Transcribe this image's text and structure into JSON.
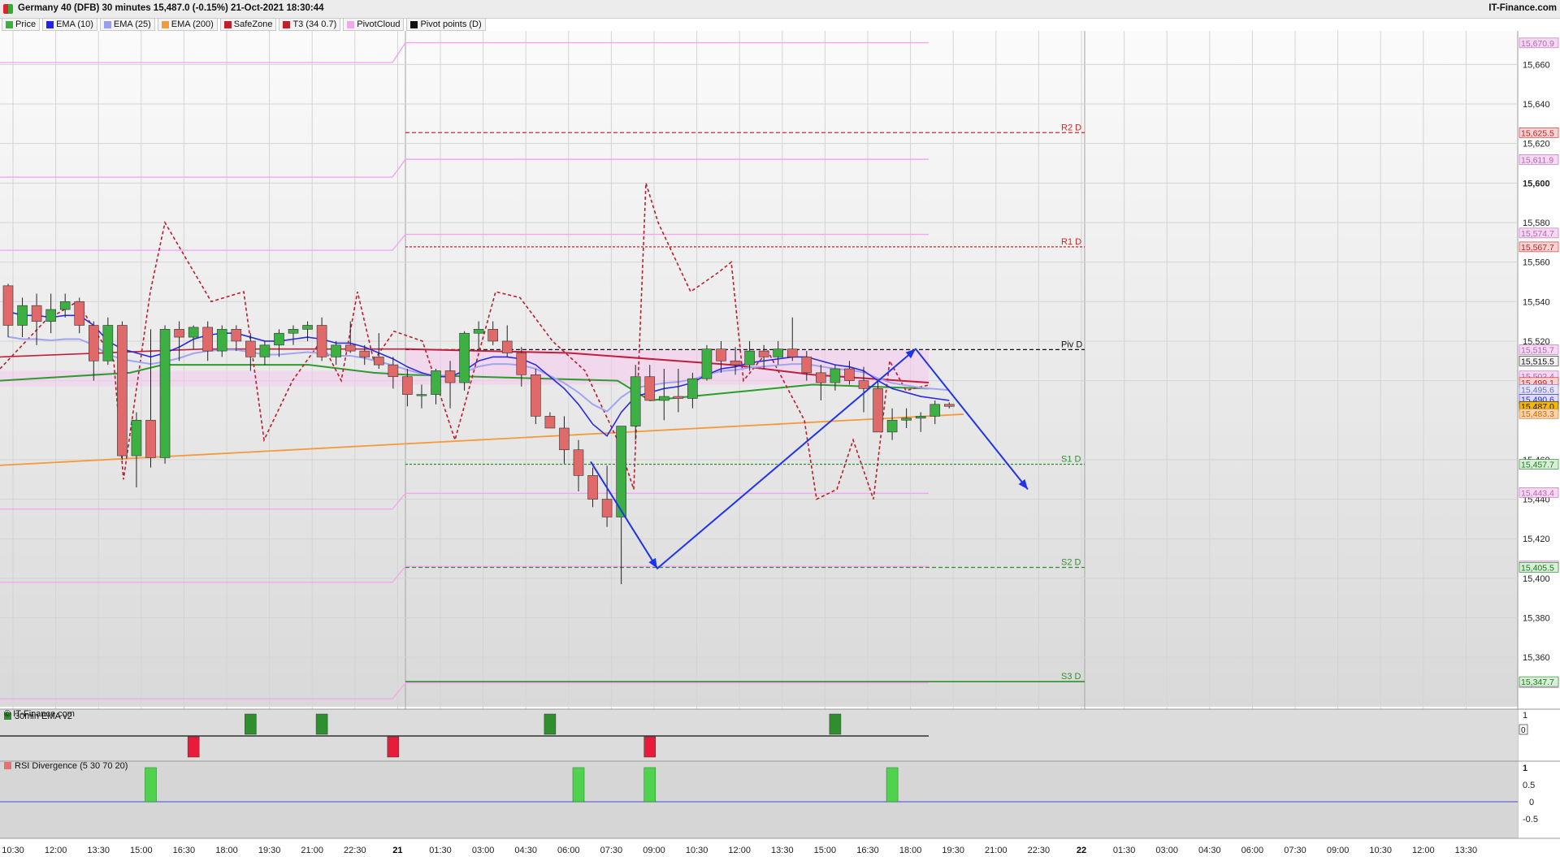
{
  "header": {
    "title": "Germany 40 (DFB) 30 minutes 15,487.0 (-0.15%) 21-Oct-2021 18:30:44",
    "brand": "IT-Finance.com"
  },
  "legend": [
    {
      "label": "Price",
      "color": "#3cb043"
    },
    {
      "label": "EMA (10)",
      "color": "#2222ee"
    },
    {
      "label": "EMA (25)",
      "color": "#9a9cf0"
    },
    {
      "label": "EMA (200)",
      "color": "#f59a3a"
    },
    {
      "label": "SafeZone",
      "color": "#c21f2c"
    },
    {
      "label": "T3 (34 0.7)",
      "color": "#c21f2c"
    },
    {
      "label": "PivotCloud",
      "color": "#f4a6f0"
    },
    {
      "label": "Pivot points (D)",
      "color": "#111111"
    }
  ],
  "watermark": "© IT-Finance.com",
  "chart_data": [
    {
      "type": "candlestick",
      "title": "Germany 40 (DFB) 30 minutes",
      "y_ticks": [
        "15,660",
        "15,640",
        "15,620",
        "15,600",
        "15,580",
        "15,560",
        "15,540",
        "15,520",
        "15,500",
        "15,460",
        "15,440",
        "15,420",
        "15,400",
        "15,380",
        "15,360"
      ],
      "x_ticks": [
        "10:30",
        "12:00",
        "13:30",
        "15:00",
        "16:30",
        "18:00",
        "19:30",
        "21:00",
        "22:30",
        "21",
        "01:30",
        "03:00",
        "04:30",
        "06:00",
        "07:30",
        "09:00",
        "10:30",
        "12:00",
        "13:30",
        "15:00",
        "16:30",
        "18:00",
        "19:30",
        "21:00",
        "22:30",
        "22",
        "01:30",
        "03:00",
        "04:30",
        "06:00",
        "07:30",
        "09:00",
        "10:30",
        "12:00",
        "13:30"
      ],
      "ylim": [
        15335,
        15677
      ],
      "candles": [
        [
          15548,
          15549,
          15522,
          15528
        ],
        [
          15528,
          15542,
          15522,
          15538
        ],
        [
          15538,
          15544,
          15518,
          15530
        ],
        [
          15530,
          15544,
          15524,
          15536
        ],
        [
          15536,
          15544,
          15532,
          15540
        ],
        [
          15540,
          15542,
          15524,
          15528
        ],
        [
          15528,
          15530,
          15500,
          15510
        ],
        [
          15510,
          15532,
          15508,
          15528
        ],
        [
          15528,
          15530,
          15460,
          15462
        ],
        [
          15462,
          15484,
          15446,
          15480
        ],
        [
          15480,
          15526,
          15456,
          15461
        ],
        [
          15461,
          15528,
          15458,
          15526
        ],
        [
          15526,
          15530,
          15510,
          15522
        ],
        [
          15522,
          15528,
          15516,
          15527
        ],
        [
          15527,
          15530,
          15510,
          15515
        ],
        [
          15515,
          15528,
          15512,
          15526
        ],
        [
          15526,
          15528,
          15515,
          15520
        ],
        [
          15520,
          15524,
          15505,
          15512
        ],
        [
          15512,
          15520,
          15508,
          15518
        ],
        [
          15518,
          15526,
          15512,
          15524
        ],
        [
          15524,
          15528,
          15518,
          15526
        ],
        [
          15526,
          15530,
          15520,
          15528
        ],
        [
          15528,
          15532,
          15510,
          15512
        ],
        [
          15512,
          15520,
          15508,
          15518
        ],
        [
          15518,
          15530,
          15514,
          15515
        ],
        [
          15515,
          15518,
          15508,
          15512
        ],
        [
          15512,
          15524,
          15506,
          15508
        ],
        [
          15508,
          15512,
          15496,
          15502
        ],
        [
          15502,
          15506,
          15487,
          15493
        ],
        [
          15493,
          15498,
          15486,
          15493
        ],
        [
          15493,
          15506,
          15488,
          15505
        ],
        [
          15505,
          15510,
          15486,
          15499
        ],
        [
          15499,
          15525,
          15495,
          15524
        ],
        [
          15524,
          15530,
          15516,
          15526
        ],
        [
          15526,
          15530,
          15518,
          15520
        ],
        [
          15520,
          15528,
          15512,
          15514
        ],
        [
          15514,
          15517,
          15497,
          15503
        ],
        [
          15503,
          15506,
          15478,
          15482
        ],
        [
          15482,
          15484,
          15476,
          15476
        ],
        [
          15476,
          15482,
          15458,
          15465
        ],
        [
          15465,
          15470,
          15444,
          15452
        ],
        [
          15452,
          15456,
          15436,
          15440
        ],
        [
          15440,
          15457,
          15426,
          15431
        ],
        [
          15431,
          15477,
          15397,
          15477
        ],
        [
          15477,
          15508,
          15470,
          15502
        ],
        [
          15502,
          15508,
          15490,
          15490
        ],
        [
          15490,
          15506,
          15480,
          15492
        ],
        [
          15492,
          15506,
          15484,
          15491
        ],
        [
          15491,
          15504,
          15486,
          15501
        ],
        [
          15501,
          15518,
          15500,
          15516
        ],
        [
          15516,
          15520,
          15504,
          15510
        ],
        [
          15510,
          15517,
          15503,
          15508
        ],
        [
          15508,
          15520,
          15505,
          15515
        ],
        [
          15515,
          15518,
          15506,
          15512
        ],
        [
          15512,
          15520,
          15508,
          15516
        ],
        [
          15516,
          15532,
          15510,
          15512
        ],
        [
          15512,
          15515,
          15500,
          15504
        ],
        [
          15504,
          15508,
          15490,
          15499
        ],
        [
          15499,
          15508,
          15495,
          15506
        ],
        [
          15506,
          15510,
          15498,
          15500
        ],
        [
          15500,
          15507,
          15484,
          15496
        ],
        [
          15496,
          15500,
          15478,
          15474
        ],
        [
          15474,
          15486,
          15470,
          15480
        ],
        [
          15480,
          15486,
          15476,
          15481
        ],
        [
          15481,
          15484,
          15474,
          15482
        ],
        [
          15482,
          15490,
          15478,
          15488
        ],
        [
          15488,
          15489,
          15486,
          15487
        ]
      ],
      "ema200_range": [
        15457,
        15483
      ],
      "pivot_levels": [
        {
          "label": "R2 D",
          "value": 15625.5,
          "color": "#e02020",
          "tag": "15,625.5"
        },
        {
          "label": "R1 D",
          "value": 15567.7,
          "color": "#e02020",
          "tag": "15,567.7"
        },
        {
          "label": "Piv D",
          "value": 15515.7,
          "color": "#111111",
          "tag": "15,515.5"
        },
        {
          "label": "S1 D",
          "value": 15457.7,
          "color": "#2f8f2f",
          "tag": "15,457.7"
        },
        {
          "label": "S2 D",
          "value": 15405.5,
          "color": "#2f8f2f",
          "tag": "15,405.5"
        },
        {
          "label": "S3 D",
          "value": 15347.7,
          "color": "#2f8f2f",
          "tag": "15,347.7"
        }
      ],
      "right_tags": [
        {
          "value": 15670.9,
          "text": "15,670.9",
          "kind": "cloud"
        },
        {
          "value": 15611.9,
          "text": "15,611.9",
          "kind": "cloud"
        },
        {
          "value": 15574.7,
          "text": "15,574.7",
          "kind": "cloud"
        },
        {
          "value": 15515.7,
          "text": "15,515.7",
          "kind": "cloud"
        },
        {
          "value": 15502.4,
          "text": "15,502.4",
          "kind": "cloud"
        },
        {
          "value": 15499.1,
          "text": "15,499.1",
          "kind": "red"
        },
        {
          "value": 15495.6,
          "text": "15,495.6",
          "kind": "lav"
        },
        {
          "value": 15490.6,
          "text": "15,490.6",
          "kind": "blue"
        },
        {
          "value": 15487.0,
          "text": "15,487.0",
          "kind": "price"
        },
        {
          "value": 15483.3,
          "text": "15,483.3",
          "kind": "orange"
        },
        {
          "value": 15443.4,
          "text": "15,443.4",
          "kind": "cloud"
        },
        {
          "value": 15406.2,
          "text": "15,406.2",
          "kind": "cloud"
        },
        {
          "value": 15347.2,
          "text": "15,347.2",
          "kind": "cloud"
        }
      ],
      "projection_path": [
        [
          15459,
          15405,
          15515,
          15445
        ]
      ],
      "bar_index_series": {
        "ema10": [
          15535,
          15533,
          15533,
          15532,
          15533,
          15533,
          15528,
          15520,
          15516,
          15514,
          15512,
          15514,
          15517,
          15521,
          15523,
          15524,
          15524,
          15522,
          15520,
          15520,
          15521,
          15522,
          15521,
          15519,
          15519,
          15517,
          15514,
          15511,
          15507,
          15504,
          15502,
          15502,
          15505,
          15510,
          15512,
          15512,
          15511,
          15508,
          15502,
          15496,
          15488,
          15478,
          15472,
          15484,
          15492,
          15494,
          15496,
          15497,
          15499,
          15503,
          15506,
          15507,
          15509,
          15510,
          15511,
          15512,
          15512,
          15510,
          15508,
          15507,
          15505,
          15500,
          15496,
          15494,
          15492,
          15491,
          15490
        ]
      }
    },
    {
      "type": "bar",
      "title": "30min EMA v2",
      "y_ticks": [
        "1",
        "0"
      ],
      "values_at_bars": {
        "13": -1,
        "17": 1,
        "22": 1,
        "27": -1,
        "38": 1,
        "45": -1,
        "58": 1
      }
    },
    {
      "type": "bar",
      "title": "RSI Divergence (5 30 70 20)",
      "y_ticks": [
        "1",
        "0.5",
        "0",
        "-0.5"
      ],
      "values_at_bars": {
        "10": 1,
        "40": 1,
        "45": 1,
        "62": 1
      }
    }
  ],
  "colors": {
    "up": "#3cb043",
    "down": "#e06a6a",
    "ema10": "#2b2be0",
    "ema25": "#a2a4f2",
    "ema200": "#f59a3a",
    "t3": "#c21f2c",
    "cloud": "#f2a8ee",
    "arrow": "#1f34e8"
  }
}
